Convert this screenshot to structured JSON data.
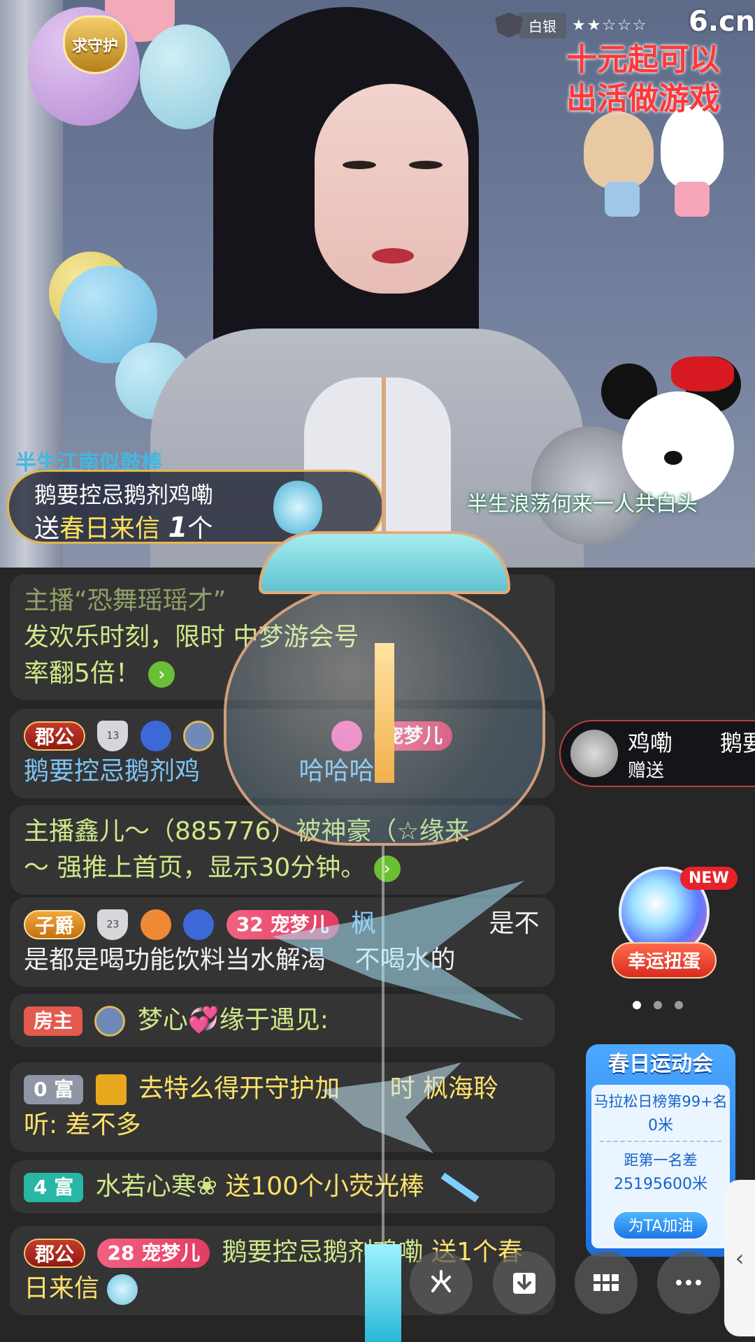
{
  "video": {
    "guard_badge": "求守护",
    "rank_level": "白银",
    "rank_stars": "★★☆☆☆",
    "site_logo": "6.cn",
    "promo_line1": "十元起可以",
    "promo_line2": "出活做游戏",
    "caption": "半生浪荡何来一人共白头",
    "top_banner": "半生江南似鼓棒"
  },
  "gift_banner": {
    "user": "鹅要控忌鹅剂鸡嘞",
    "send": "送",
    "gift": "春日来信",
    "count": "1",
    "unit": "个"
  },
  "chat": {
    "m1_line1": "主播“恐舞瑶瑶才”",
    "m1_line2": "发欢乐时刻，限时",
    "m1_line2b": "中梦游会号",
    "m1_line3": "率翻5倍！",
    "m2_tag": "郡公",
    "m2_shield": "13",
    "m2_fan": "宠梦儿",
    "m2_text": "鹅要控忌鹅剂鸡",
    "m2_text_tail": "哈哈哈",
    "m3_line1": "主播鑫儿～（885776）被神豪（☆缘来",
    "m3_line2": "～ 强推上首页，显示30分钟。",
    "m4_tag": "子爵",
    "m4_shield": "23",
    "m4_fan_lv": "32",
    "m4_fan": "宠梦儿",
    "m4_name": "枫",
    "m4_text1": "是不",
    "m4_text2": "是都是喝功能饮料当水解渴",
    "m4_text3": "不喝水的",
    "m5_tag": "房主",
    "m5_text": "梦心💞缘于遇见:",
    "m6_tag": "0 富",
    "m6_text": "去特么得开守护加",
    "m6_text_b": "时 枫海聆",
    "m6_text2": "听: 差不多",
    "m7_tag": "4 富",
    "m7_name": "水若心寒❀",
    "m7_text": "送100个小荧光棒",
    "m8_tag": "郡公",
    "m8_fan_lv": "28",
    "m8_fan": "宠梦儿",
    "m8_name": "鹅要控忌鹅剂鸡嘞",
    "m8_text": "送1个春",
    "m8_text2": "日来信"
  },
  "gift_toast": {
    "name": "鸡嘞",
    "name2": "鹅要",
    "action": "赠送"
  },
  "gacha": {
    "new": "NEW",
    "label": "幸运扭蛋"
  },
  "sports": {
    "title": "春日运动会",
    "rank_text": "马拉松日榜第99+名",
    "distance": "0米",
    "gap_label": "距第一名差",
    "gap_value": "25195600米",
    "cheer": "为TA加油"
  },
  "icons": {
    "share": "share-icon",
    "download": "download-icon",
    "grid": "grid-icon",
    "more": "more-icon",
    "chevron": "‹"
  }
}
